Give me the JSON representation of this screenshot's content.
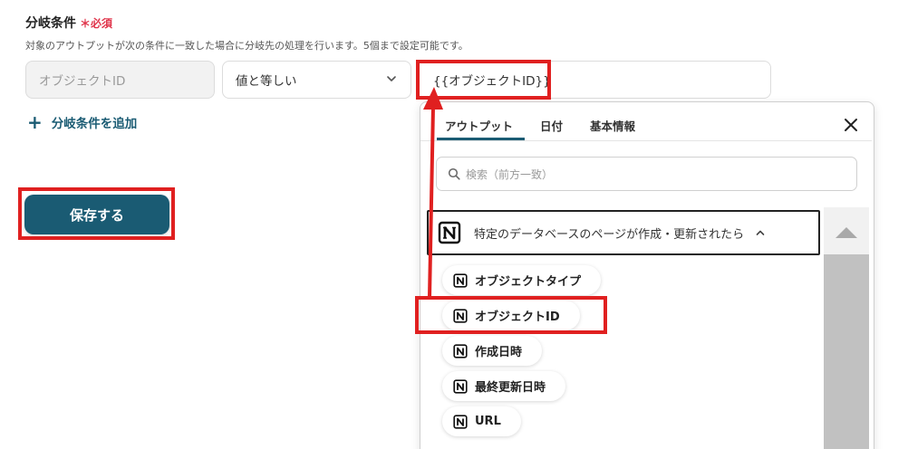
{
  "form": {
    "title": "分岐条件",
    "required_label": "＊必須",
    "description": "対象のアウトプットが次の条件に一致した場合に分岐先の処理を行います。5個まで設定可能です。",
    "condition": {
      "field_placeholder": "オブジェクトID",
      "operator": "値と等しい",
      "value": "{{オブジェクトID}}"
    },
    "add_condition_label": "分岐条件を追加",
    "save_label": "保存する"
  },
  "picker": {
    "tabs": [
      {
        "label": "アウトプット",
        "active": true
      },
      {
        "label": "日付",
        "active": false
      },
      {
        "label": "基本情報",
        "active": false
      }
    ],
    "search_placeholder": "検索（前方一致）",
    "group_label": "特定のデータベースのページが作成・更新されたら",
    "items": [
      {
        "label": "オブジェクトタイプ",
        "icon": "notion-icon"
      },
      {
        "label": "オブジェクトID",
        "icon": "notion-icon",
        "highlighted": true
      },
      {
        "label": "作成日時",
        "icon": "notion-icon"
      },
      {
        "label": "最終更新日時",
        "icon": "notion-icon"
      },
      {
        "label": "URL",
        "icon": "notion-icon"
      }
    ]
  },
  "colors": {
    "accent": "#1a5b73",
    "required": "#e0344a",
    "annotation": "#e02020"
  }
}
